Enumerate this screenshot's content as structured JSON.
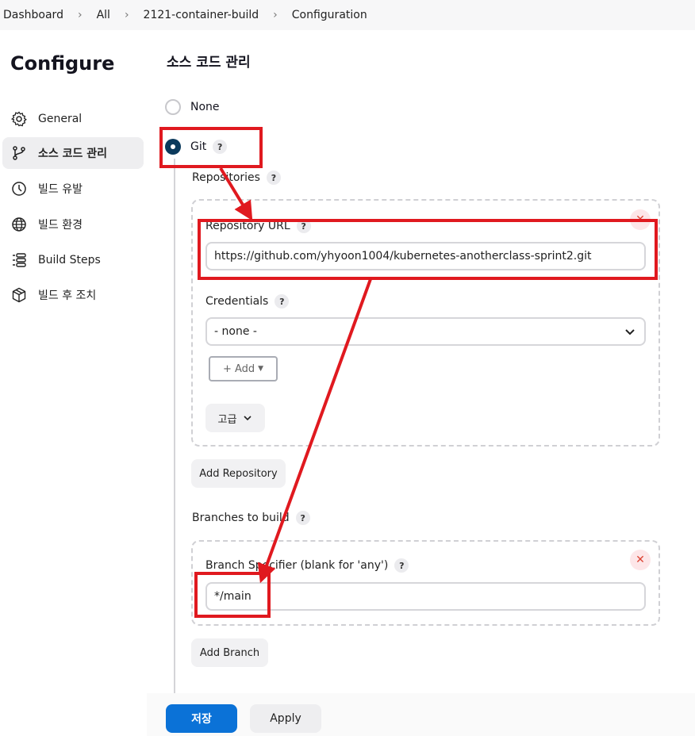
{
  "breadcrumb": [
    "Dashboard",
    "All",
    "2121-container-build",
    "Configuration"
  ],
  "sidebar": {
    "title": "Configure",
    "items": [
      {
        "label": "General",
        "icon": "gear-icon"
      },
      {
        "label": "소스 코드 관리",
        "icon": "branch-icon"
      },
      {
        "label": "빌드 유발",
        "icon": "timer-icon"
      },
      {
        "label": "빌드 환경",
        "icon": "globe-icon"
      },
      {
        "label": "Build Steps",
        "icon": "list-icon"
      },
      {
        "label": "빌드 후 조치",
        "icon": "package-icon"
      }
    ]
  },
  "main": {
    "section_title": "소스 코드 관리",
    "scm_none": "None",
    "scm_git": "Git",
    "help_glyph": "?",
    "repositories_label": "Repositories",
    "repository_url_label": "Repository URL",
    "repository_url_value": "https://github.com/yhyoon1004/kubernetes-anotherclass-sprint2.git",
    "credentials_label": "Credentials",
    "credentials_value": "- none -",
    "add_label": "+ Add",
    "advanced_label": "고급",
    "add_repository_label": "Add Repository",
    "branches_label": "Branches to build",
    "branch_specifier_label": "Branch Specifier (blank for 'any')",
    "branch_specifier_value": "*/main",
    "add_branch_label": "Add Branch"
  },
  "footer": {
    "save_label": "저장",
    "apply_label": "Apply"
  },
  "colors": {
    "primary": "#0b72d7",
    "annotation": "#e0191f",
    "radio_checked": "#0b3a5c"
  }
}
